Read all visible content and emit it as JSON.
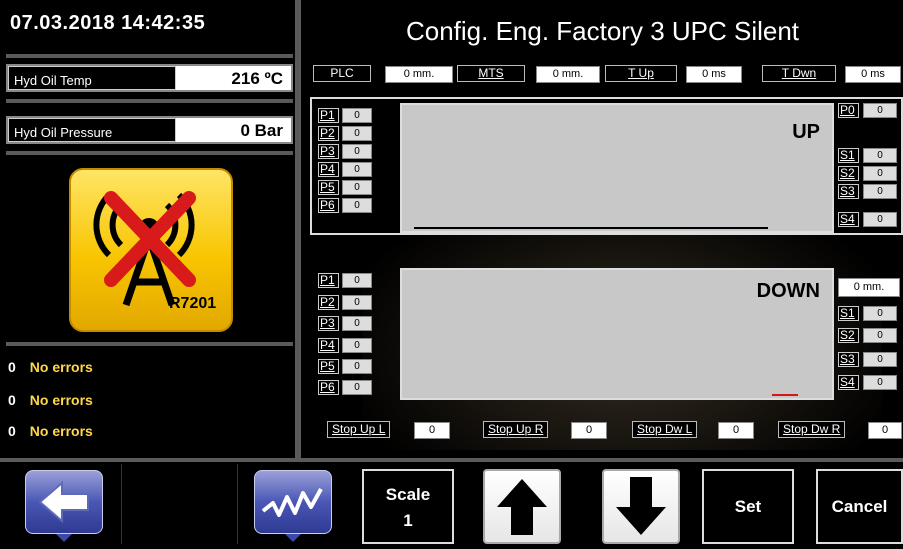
{
  "header": {
    "datetime": "07.03.2018  14:42:35",
    "title": "Config. Eng. Factory 3 UPC Silent"
  },
  "sensors": [
    {
      "label": "Hyd Oil Temp",
      "value": "216 ºC"
    },
    {
      "label": "Hyd Oil Pressure",
      "value": "0 Bar"
    }
  ],
  "alarm": {
    "code": "R7201",
    "icon": "antenna-disconnected-icon"
  },
  "errors": [
    {
      "count": "0",
      "text": "No errors"
    },
    {
      "count": "0",
      "text": "No errors"
    },
    {
      "count": "0",
      "text": "No errors"
    }
  ],
  "top_readouts": [
    {
      "label": "PLC",
      "value": "0 mm."
    },
    {
      "label": "MTS",
      "value": "0 mm."
    },
    {
      "label": "T Up",
      "value": "0 ms"
    },
    {
      "label": "T Dwn",
      "value": "0 ms"
    }
  ],
  "up_panel": {
    "title": "UP",
    "left": [
      {
        "label": "P1",
        "value": "0"
      },
      {
        "label": "P2",
        "value": "0"
      },
      {
        "label": "P3",
        "value": "0"
      },
      {
        "label": "P4",
        "value": "0"
      },
      {
        "label": "P5",
        "value": "0"
      },
      {
        "label": "P6",
        "value": "0"
      }
    ],
    "p0": {
      "label": "P0",
      "value": "0"
    },
    "right": [
      {
        "label": "S1",
        "value": "0"
      },
      {
        "label": "S2",
        "value": "0"
      },
      {
        "label": "S3",
        "value": "0"
      },
      {
        "label": "S4",
        "value": "0"
      }
    ]
  },
  "down_panel": {
    "title": "DOWN",
    "left": [
      {
        "label": "P1",
        "value": "0"
      },
      {
        "label": "P2",
        "value": "0"
      },
      {
        "label": "P3",
        "value": "0"
      },
      {
        "label": "P4",
        "value": "0"
      },
      {
        "label": "P5",
        "value": "0"
      },
      {
        "label": "P6",
        "value": "0"
      }
    ],
    "mm": "0 mm.",
    "right": [
      {
        "label": "S1",
        "value": "0"
      },
      {
        "label": "S2",
        "value": "0"
      },
      {
        "label": "S3",
        "value": "0"
      },
      {
        "label": "S4",
        "value": "0"
      }
    ]
  },
  "stops": [
    {
      "label": "Stop Up L",
      "value": "0"
    },
    {
      "label": "Stop Up R",
      "value": "0"
    },
    {
      "label": "Stop Dw L",
      "value": "0"
    },
    {
      "label": "Stop Dw R",
      "value": "0"
    }
  ],
  "toolbar": {
    "back_icon": "back-arrow-icon",
    "trend_icon": "trend-graph-icon",
    "scale_label": "Scale",
    "scale_value": "1",
    "up_icon": "arrow-up-icon",
    "down_icon": "arrow-down-icon",
    "set_label": "Set",
    "cancel_label": "Cancel"
  },
  "colors": {
    "error_text": "#ffd84a",
    "alarm_bg": "#f8c500",
    "nav_button": "#4a57b5",
    "plot_bg": "#c8c8c8"
  }
}
